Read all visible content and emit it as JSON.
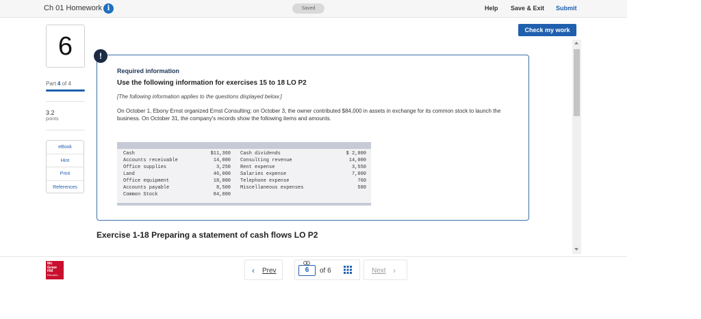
{
  "header": {
    "assignment_title": "Ch 01 Homework",
    "info_icon": "i",
    "save_status": "Saved",
    "help_label": "Help",
    "save_exit_label": "Save & Exit",
    "submit_label": "Submit"
  },
  "check_button_label": "Check my work",
  "sidebar": {
    "question_number": "6",
    "part_prefix": "Part",
    "part_current": "4",
    "part_suffix": "of 4",
    "points_value": "3.2",
    "points_label": "points",
    "resources": [
      {
        "label": "eBook"
      },
      {
        "label": "Hint"
      },
      {
        "label": "Print"
      },
      {
        "label": "References"
      }
    ]
  },
  "info_card": {
    "alert_icon": "!",
    "heading": "Required information",
    "subheading": "Use the following information for exercises 15 to 18 LO P2",
    "applies_note": "[The following information applies to the questions displayed below.]",
    "body": "On October 1, Ebony Ernst organized Ernst Consulting; on October 3, the owner contributed $84,000 in assets in exchange for its common stock to launch the business. On October 31, the company's records show the following items and amounts.",
    "table_rows": [
      {
        "left_label": "Cash",
        "left_value": "$11,360",
        "right_label": "Cash dividends",
        "right_value": "$ 2,000"
      },
      {
        "left_label": "Accounts receivable",
        "left_value": "14,000",
        "right_label": "Consulting revenue",
        "right_value": "14,000"
      },
      {
        "left_label": "Office supplies",
        "left_value": "3,250",
        "right_label": "Rent expense",
        "right_value": "3,550"
      },
      {
        "left_label": "Land",
        "left_value": "46,000",
        "right_label": "Salaries expense",
        "right_value": "7,000"
      },
      {
        "left_label": "Office equipment",
        "left_value": "18,000",
        "right_label": "Telephone expense",
        "right_value": "760"
      },
      {
        "left_label": "Accounts payable",
        "left_value": "8,500",
        "right_label": "Miscellaneous expenses",
        "right_value": "580"
      },
      {
        "left_label": "Common Stock",
        "left_value": "84,000",
        "right_label": "",
        "right_value": ""
      }
    ]
  },
  "exercise_title": "Exercise 1-18 Preparing a statement of cash flows LO P2",
  "footer": {
    "logo_lines": [
      "Mc",
      "Graw",
      "Hill"
    ],
    "logo_sub": "Education",
    "prev_label": "Prev",
    "current_page": "6",
    "total_pages_text": "of 6",
    "next_label": "Next"
  },
  "colors": {
    "accent": "#1f5fae",
    "card_border": "#3b6fa8",
    "logo_red": "#c8102e"
  }
}
